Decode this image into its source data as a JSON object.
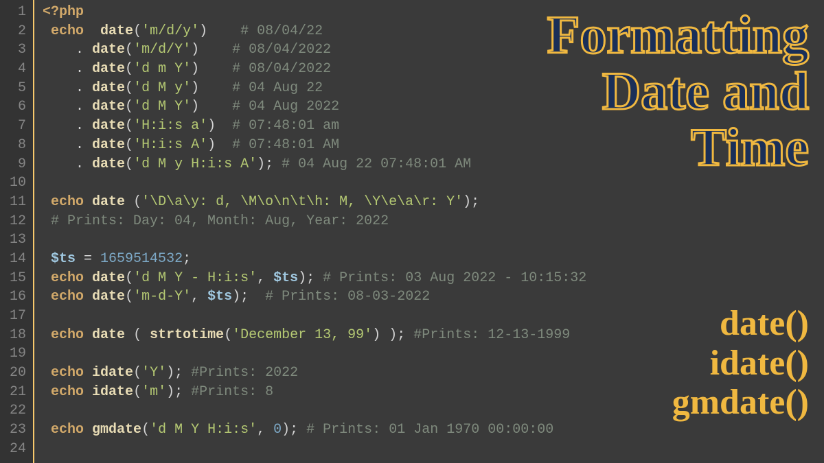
{
  "title": {
    "line1": "Formatting",
    "line2": "Date and",
    "line3": "Time"
  },
  "functions": {
    "fn1": "date()",
    "fn2": "idate()",
    "fn3": "gmdate()"
  },
  "gutter": {
    "1": "1",
    "2": "2",
    "3": "3",
    "4": "4",
    "5": "5",
    "6": "6",
    "7": "7",
    "8": "8",
    "9": "9",
    "10": "10",
    "11": "11",
    "12": "12",
    "13": "13",
    "14": "14",
    "15": "15",
    "16": "16",
    "17": "17",
    "18": "18",
    "19": "19",
    "20": "20",
    "21": "21",
    "22": "22",
    "23": "23",
    "24": "24"
  },
  "code": {
    "l1": {
      "php": "<?php"
    },
    "l2": {
      "kw": "echo",
      "sp1": "  ",
      "fn": "date",
      "op1": "(",
      "str": "'m/d/y'",
      "op2": ")",
      "sp2": "    ",
      "cmt": "# 08/04/22"
    },
    "l3": {
      "indent": "    ",
      "dot": ". ",
      "fn": "date",
      "op1": "(",
      "str": "'m/d/Y'",
      "op2": ")",
      "sp2": "    ",
      "cmt": "# 08/04/2022"
    },
    "l4": {
      "indent": "    ",
      "dot": ". ",
      "fn": "date",
      "op1": "(",
      "str": "'d m Y'",
      "op2": ")",
      "sp2": "    ",
      "cmt": "# 08/04/2022"
    },
    "l5": {
      "indent": "    ",
      "dot": ". ",
      "fn": "date",
      "op1": "(",
      "str": "'d M y'",
      "op2": ")",
      "sp2": "    ",
      "cmt": "# 04 Aug 22"
    },
    "l6": {
      "indent": "    ",
      "dot": ". ",
      "fn": "date",
      "op1": "(",
      "str": "'d M Y'",
      "op2": ")",
      "sp2": "    ",
      "cmt": "# 04 Aug 2022"
    },
    "l7": {
      "indent": "    ",
      "dot": ". ",
      "fn": "date",
      "op1": "(",
      "str": "'H:i:s a'",
      "op2": ")",
      "sp2": "  ",
      "cmt": "# 07:48:01 am"
    },
    "l8": {
      "indent": "    ",
      "dot": ". ",
      "fn": "date",
      "op1": "(",
      "str": "'H:i:s A'",
      "op2": ")",
      "sp2": "  ",
      "cmt": "# 07:48:01 AM"
    },
    "l9": {
      "indent": "    ",
      "dot": ". ",
      "fn": "date",
      "op1": "(",
      "str": "'d M y H:i:s A'",
      "op2": ");",
      "sp2": " ",
      "cmt": "# 04 Aug 22 07:48:01 AM"
    },
    "l11": {
      "kw": "echo",
      "sp1": " ",
      "fn": "date",
      "sp2": " ",
      "op1": "(",
      "str": "'\\D\\a\\y: d, \\M\\o\\n\\t\\h: M, \\Y\\e\\a\\r: Y'",
      "op2": ");"
    },
    "l12": {
      "cmt": "# Prints: Day: 04, Month: Aug, Year: 2022"
    },
    "l14": {
      "var": "$ts",
      "eq": " = ",
      "num": "1659514532",
      "semi": ";"
    },
    "l15": {
      "kw": "echo",
      "sp1": " ",
      "fn": "date",
      "op1": "(",
      "str": "'d M Y - H:i:s'",
      "comma": ", ",
      "var": "$ts",
      "op2": ");",
      "sp2": " ",
      "cmt": "# Prints: 03 Aug 2022 - 10:15:32"
    },
    "l16": {
      "kw": "echo",
      "sp1": " ",
      "fn": "date",
      "op1": "(",
      "str": "'m-d-Y'",
      "comma": ", ",
      "var": "$ts",
      "op2": ");",
      "sp2": "  ",
      "cmt": "# Prints: 08-03-2022"
    },
    "l18": {
      "kw": "echo",
      "sp1": " ",
      "fn": "date",
      "sp2": " ",
      "op1": "( ",
      "fn2": "strtotime",
      "op3": "(",
      "str": "'December 13, 99'",
      "op4": ") );",
      "sp3": " ",
      "cmt": "#Prints: 12-13-1999"
    },
    "l20": {
      "kw": "echo",
      "sp1": " ",
      "fn": "idate",
      "op1": "(",
      "str": "'Y'",
      "op2": ");",
      "sp2": " ",
      "cmt": "#Prints: 2022"
    },
    "l21": {
      "kw": "echo",
      "sp1": " ",
      "fn": "idate",
      "op1": "(",
      "str": "'m'",
      "op2": ");",
      "sp2": " ",
      "cmt": "#Prints: 8"
    },
    "l23": {
      "kw": "echo",
      "sp1": " ",
      "fn": "gmdate",
      "op1": "(",
      "str": "'d M Y H:i:s'",
      "comma": ", ",
      "num": "0",
      "op2": ");",
      "sp2": " ",
      "cmt": "# Prints: 01 Jan 1970 00:00:00"
    }
  }
}
